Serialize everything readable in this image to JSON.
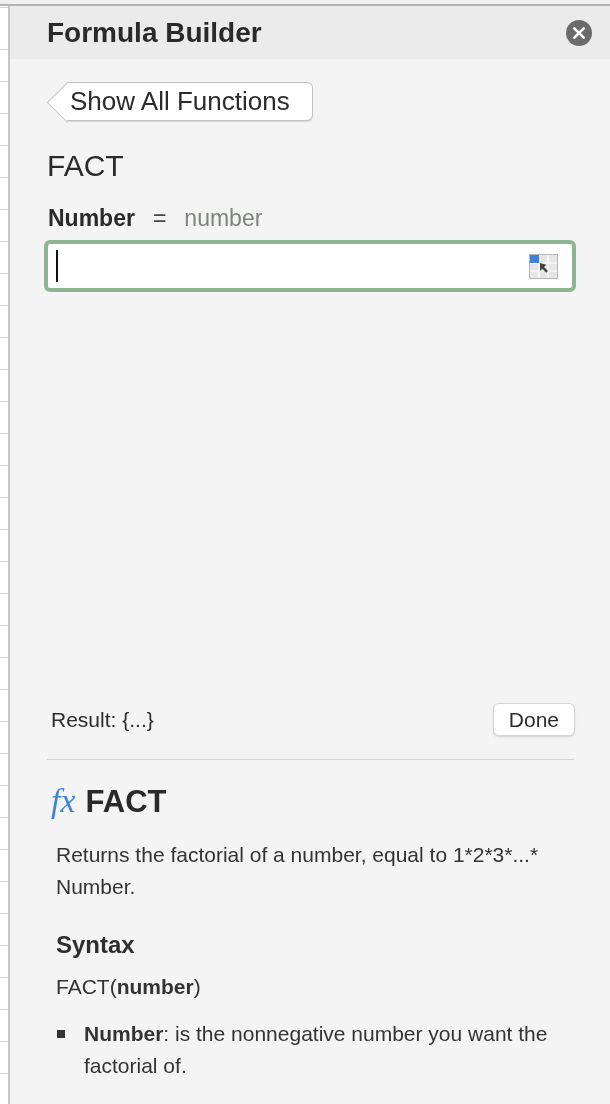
{
  "panel": {
    "title": "Formula Builder"
  },
  "back_button": {
    "label": "Show All Functions"
  },
  "function": {
    "name": "FACT",
    "arguments": [
      {
        "name": "Number",
        "equals": "=",
        "type_hint": "number",
        "focused": true
      }
    ]
  },
  "result": {
    "label": "Result: {...}"
  },
  "done_button": {
    "label": "Done"
  },
  "help": {
    "icon_text": "fx",
    "title": "FACT",
    "description": "Returns the factorial of a number, equal to 1*2*3*...* Number.",
    "syntax_heading": "Syntax",
    "syntax": "FACT(**number**)",
    "arguments": [
      "**Number**: is the nonnegative number you want the factorial of."
    ]
  }
}
